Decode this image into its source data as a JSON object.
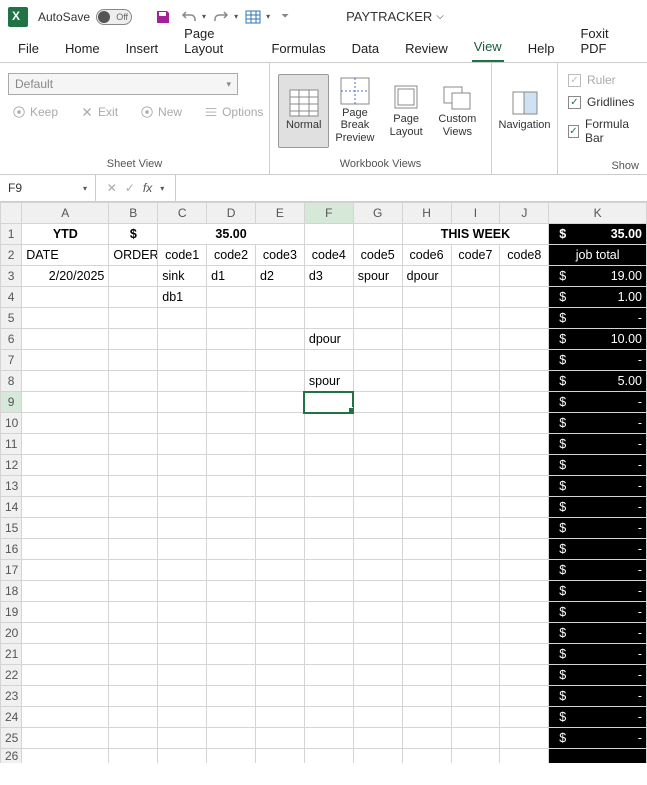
{
  "titlebar": {
    "autosave_label": "AutoSave",
    "toggle_state": "Off",
    "filename": "PAYTRACKER"
  },
  "menu": {
    "tabs": [
      "File",
      "Home",
      "Insert",
      "Page Layout",
      "Formulas",
      "Data",
      "Review",
      "View",
      "Help",
      "Foxit PDF"
    ],
    "active": "View"
  },
  "ribbon": {
    "sheetview": {
      "group_label": "Sheet View",
      "select_value": "Default",
      "keep": "Keep",
      "exit": "Exit",
      "new": "New",
      "options": "Options"
    },
    "workbookviews": {
      "group_label": "Workbook Views",
      "normal": "Normal",
      "pagebreak": "Page Break Preview",
      "pagelayout": "Page Layout",
      "custom": "Custom Views"
    },
    "nav": {
      "label": "Navigation"
    },
    "show": {
      "group_label": "Show",
      "ruler": "Ruler",
      "gridlines": "Gridlines",
      "formulabar": "Formula Bar"
    }
  },
  "formulabar": {
    "namebox": "F9",
    "fx_label": "fx",
    "value": ""
  },
  "columns": [
    "A",
    "B",
    "C",
    "D",
    "E",
    "F",
    "G",
    "H",
    "I",
    "J",
    "K"
  ],
  "row_headers": [
    "1",
    "2",
    "3",
    "4",
    "5",
    "6",
    "7",
    "8",
    "9",
    "10",
    "11",
    "12",
    "13",
    "14",
    "15",
    "16",
    "17",
    "18",
    "19",
    "20",
    "21",
    "22",
    "23",
    "24",
    "25",
    "26"
  ],
  "selected": {
    "col": "F",
    "row": "9"
  },
  "row1": {
    "ytd": "YTD",
    "dollar": "$",
    "total": "35.00",
    "thisweek": "THIS WEEK",
    "k_dollar": "$",
    "k_total": "35.00"
  },
  "row2": {
    "date": "DATE",
    "order": "ORDER",
    "c1": "code1",
    "c2": "code2",
    "c3": "code3",
    "c4": "code4",
    "c5": "code5",
    "c6": "code6",
    "c7": "code7",
    "c8": "code8",
    "jobtotal": "job total"
  },
  "data_rows": [
    {
      "A": "2/20/2025",
      "B": "",
      "C": "sink",
      "D": "d1",
      "E": "d2",
      "F": "d3",
      "G": "spour",
      "H": "dpour",
      "I": "",
      "J": "",
      "K": "19.00"
    },
    {
      "A": "",
      "B": "",
      "C": "db1",
      "D": "",
      "E": "",
      "F": "",
      "G": "",
      "H": "",
      "I": "",
      "J": "",
      "K": "1.00"
    },
    {
      "A": "",
      "B": "",
      "C": "",
      "D": "",
      "E": "",
      "F": "",
      "G": "",
      "H": "",
      "I": "",
      "J": "",
      "K": "-"
    },
    {
      "A": "",
      "B": "",
      "C": "",
      "D": "",
      "E": "",
      "F": "dpour",
      "G": "",
      "H": "",
      "I": "",
      "J": "",
      "K": "10.00"
    },
    {
      "A": "",
      "B": "",
      "C": "",
      "D": "",
      "E": "",
      "F": "",
      "G": "",
      "H": "",
      "I": "",
      "J": "",
      "K": "-"
    },
    {
      "A": "",
      "B": "",
      "C": "",
      "D": "",
      "E": "",
      "F": "spour",
      "G": "",
      "H": "",
      "I": "",
      "J": "",
      "K": "5.00"
    },
    {
      "A": "",
      "B": "",
      "C": "",
      "D": "",
      "E": "",
      "F": "",
      "G": "",
      "H": "",
      "I": "",
      "J": "",
      "K": "-"
    },
    {
      "A": "",
      "B": "",
      "C": "",
      "D": "",
      "E": "",
      "F": "",
      "G": "",
      "H": "",
      "I": "",
      "J": "",
      "K": "-"
    },
    {
      "A": "",
      "B": "",
      "C": "",
      "D": "",
      "E": "",
      "F": "",
      "G": "",
      "H": "",
      "I": "",
      "J": "",
      "K": "-"
    },
    {
      "A": "",
      "B": "",
      "C": "",
      "D": "",
      "E": "",
      "F": "",
      "G": "",
      "H": "",
      "I": "",
      "J": "",
      "K": "-"
    },
    {
      "A": "",
      "B": "",
      "C": "",
      "D": "",
      "E": "",
      "F": "",
      "G": "",
      "H": "",
      "I": "",
      "J": "",
      "K": "-"
    },
    {
      "A": "",
      "B": "",
      "C": "",
      "D": "",
      "E": "",
      "F": "",
      "G": "",
      "H": "",
      "I": "",
      "J": "",
      "K": "-"
    },
    {
      "A": "",
      "B": "",
      "C": "",
      "D": "",
      "E": "",
      "F": "",
      "G": "",
      "H": "",
      "I": "",
      "J": "",
      "K": "-"
    },
    {
      "A": "",
      "B": "",
      "C": "",
      "D": "",
      "E": "",
      "F": "",
      "G": "",
      "H": "",
      "I": "",
      "J": "",
      "K": "-"
    },
    {
      "A": "",
      "B": "",
      "C": "",
      "D": "",
      "E": "",
      "F": "",
      "G": "",
      "H": "",
      "I": "",
      "J": "",
      "K": "-"
    },
    {
      "A": "",
      "B": "",
      "C": "",
      "D": "",
      "E": "",
      "F": "",
      "G": "",
      "H": "",
      "I": "",
      "J": "",
      "K": "-"
    },
    {
      "A": "",
      "B": "",
      "C": "",
      "D": "",
      "E": "",
      "F": "",
      "G": "",
      "H": "",
      "I": "",
      "J": "",
      "K": "-"
    },
    {
      "A": "",
      "B": "",
      "C": "",
      "D": "",
      "E": "",
      "F": "",
      "G": "",
      "H": "",
      "I": "",
      "J": "",
      "K": "-"
    },
    {
      "A": "",
      "B": "",
      "C": "",
      "D": "",
      "E": "",
      "F": "",
      "G": "",
      "H": "",
      "I": "",
      "J": "",
      "K": "-"
    },
    {
      "A": "",
      "B": "",
      "C": "",
      "D": "",
      "E": "",
      "F": "",
      "G": "",
      "H": "",
      "I": "",
      "J": "",
      "K": "-"
    },
    {
      "A": "",
      "B": "",
      "C": "",
      "D": "",
      "E": "",
      "F": "",
      "G": "",
      "H": "",
      "I": "",
      "J": "",
      "K": "-"
    },
    {
      "A": "",
      "B": "",
      "C": "",
      "D": "",
      "E": "",
      "F": "",
      "G": "",
      "H": "",
      "I": "",
      "J": "",
      "K": "-"
    },
    {
      "A": "",
      "B": "",
      "C": "",
      "D": "",
      "E": "",
      "F": "",
      "G": "",
      "H": "",
      "I": "",
      "J": "",
      "K": "-"
    },
    {
      "A": "",
      "B": "",
      "C": "",
      "D": "",
      "E": "",
      "F": "",
      "G": "",
      "H": "",
      "I": "",
      "J": "",
      "K": ""
    }
  ]
}
